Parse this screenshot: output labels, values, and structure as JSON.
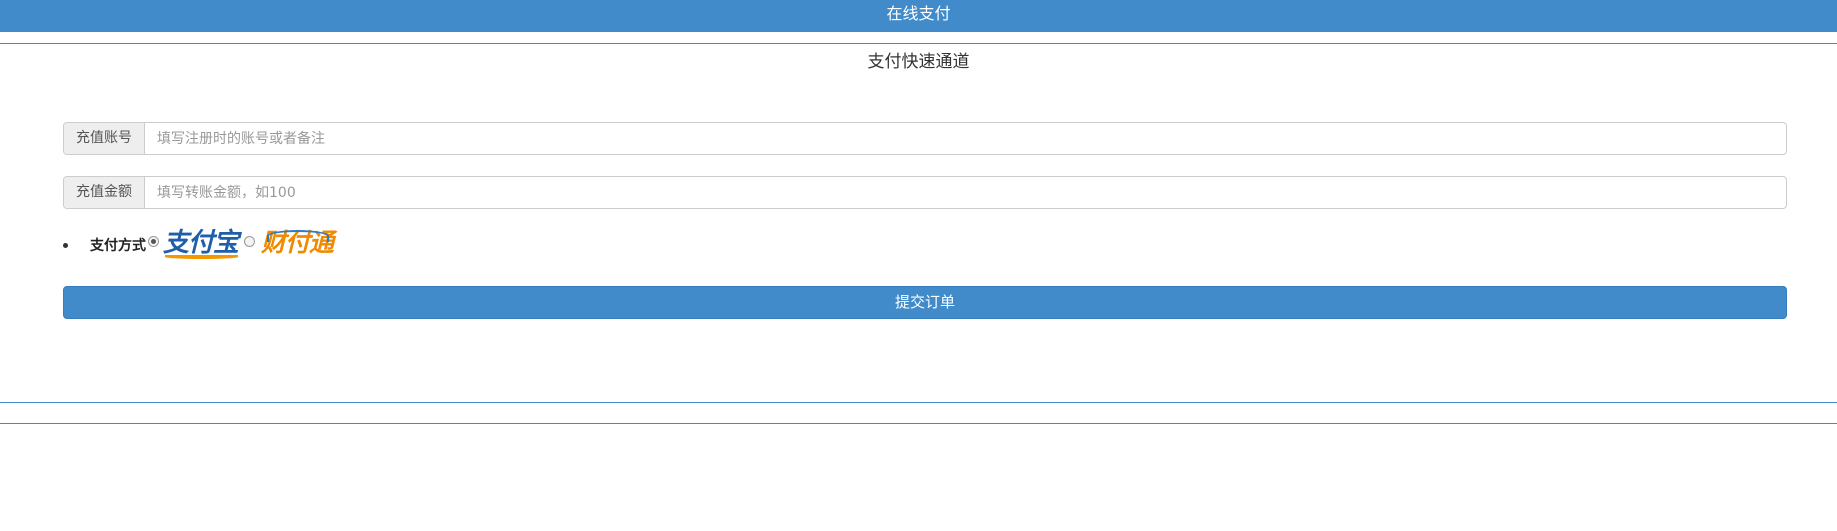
{
  "header": {
    "title": "在线支付"
  },
  "section": {
    "title": "支付快速通道"
  },
  "form": {
    "account": {
      "label": "充值账号",
      "value": "",
      "placeholder": "填写注册时的账号或者备注"
    },
    "amount": {
      "label": "充值金额",
      "value": "",
      "placeholder": "填写转账金额，如100"
    },
    "payment_method": {
      "label": "支付方式",
      "options": [
        {
          "logo_text": "支付宝",
          "icon": "alipay-logo",
          "selected": true
        },
        {
          "logo_text": "财付通",
          "icon": "tenpay-logo",
          "selected": false
        }
      ]
    },
    "submit_label": "提交订单"
  },
  "colors": {
    "primary": "#428bca",
    "addon_bg": "#eeeeee",
    "border": "#cccccc",
    "alipay_blue": "#1f5ea8",
    "alipay_orange": "#f39800",
    "tenpay_orange": "#f08a00",
    "tenpay_blue": "#2a7bc8"
  }
}
